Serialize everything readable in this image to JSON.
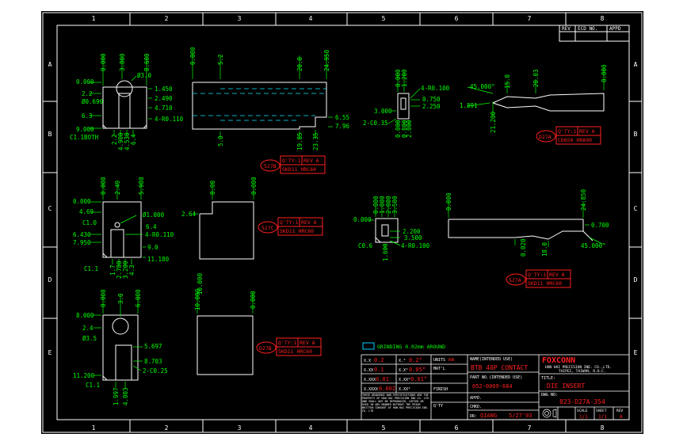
{
  "zones": {
    "cols": [
      "1",
      "2",
      "3",
      "4",
      "5",
      "6",
      "7",
      "8"
    ],
    "rows": [
      "A",
      "B",
      "C",
      "D",
      "E"
    ]
  },
  "revision_block": {
    "rev": "REV",
    "ecd_no": "ECD NO.",
    "appd": "APPD"
  },
  "colors": {
    "background": "#000000",
    "outline": "#ffffff",
    "dimension": "#00ff00",
    "hidden": "#00e5ff",
    "tag": "#ff2020",
    "text": "#ffffff"
  },
  "views": {
    "a1": {
      "dims_top": [
        "0.000",
        "3.800",
        "8.600"
      ],
      "dims_left": [
        "0.000",
        "2.2",
        "Ø0.690",
        "6.3",
        "9.000",
        "C1.1BOTH"
      ],
      "dims_right": [
        "Ø3.0",
        "1.450",
        "2.490",
        "4.710",
        "4-R0.110"
      ],
      "dims_bottom": [
        "2.2",
        "4.900",
        "4.530",
        "6.4"
      ]
    },
    "a2": {
      "dims_top": [
        "0.000",
        "5.2",
        "20.0",
        "24.950"
      ],
      "dims_right": [
        "6.55",
        "7.96"
      ],
      "dims_bottom": [
        "5.0",
        "19.85",
        "23.35"
      ],
      "tag_code": "527B",
      "tag_qty": "Q'TY:1",
      "tag_rev": "REV A",
      "tag_mat": "SKD11 HRC60"
    },
    "a3": {
      "dims": [
        "0.000",
        "1.200",
        "4-R0.100",
        "0.750",
        "2.250",
        "3.000",
        "2-C0.35",
        "0.000",
        "0.800",
        "2.000"
      ]
    },
    "a4": {
      "dims": [
        "45.000°",
        "15.0",
        "20.03",
        "0.000",
        "1.891",
        "21.200"
      ],
      "tag_code": "D27A",
      "tag_qty": "Q'TY:1",
      "tag_rev": "REV A",
      "tag_mat": "CD650 HRA90"
    },
    "c1": {
      "dims_top": [
        "0.000",
        "2.49",
        "5.980"
      ],
      "dims_left": [
        "0.000",
        "4.69",
        "C1.0",
        "6.430",
        "7.950",
        "C1.1"
      ],
      "dims_right": [
        "Ø1.000",
        "6.4",
        "4-R0.110",
        "9.0",
        "11.180"
      ],
      "dims_bottom": [
        "1.7",
        "2.780",
        "3.200",
        "4.3"
      ]
    },
    "c2": {
      "dims": [
        "8.00",
        "0.000",
        "2.64",
        "10.000"
      ],
      "tag_code": "527C",
      "tag_qty": "Q'TY:1",
      "tag_rev": "REV A",
      "tag_mat": "SKD11 HRC60"
    },
    "c3": {
      "dims": [
        "0.000",
        "1.000",
        "2.000",
        "3.500",
        "0.000",
        "2.200",
        "3.500",
        "4-R0.100",
        "C0.6",
        "1.600"
      ]
    },
    "c4": {
      "dims": [
        "0.000",
        "24.850",
        "0.700",
        "45.000°",
        "0.020",
        "18.0"
      ],
      "tag_code": "527A",
      "tag_qty": "Q'TY:1",
      "tag_rev": "REV A",
      "tag_mat": "SKD11 HRC60"
    },
    "d1": {
      "dims_top": [
        "0.000",
        "3.0",
        "6.000"
      ],
      "dims_left": [
        "8.000",
        "2.4",
        "Ø3.5",
        "11.200",
        "C1.1"
      ],
      "dims_right": [
        "5.697",
        "8.703",
        "2-C0.25"
      ],
      "dims_bottom": [
        "1.997",
        "4.003"
      ]
    },
    "d2": {
      "dims": [
        "10.000",
        "0.000"
      ],
      "tag_code": "D27B",
      "tag_qty": "Q'TY:1",
      "tag_rev": "REV A",
      "tag_mat": "SKD11 HRC60"
    }
  },
  "grinding_note": "GRINDING 0.02mm AROUND",
  "title_block": {
    "tolerances": [
      {
        "x": "X.X",
        "val": "0.2",
        "deg": "X.°",
        "dval": "0.2°"
      },
      {
        "x": "X.XX",
        "val": "0.1",
        "deg": "X.X°",
        "dval": "0.05°"
      },
      {
        "x": "X.XXX",
        "val": "0.01",
        "deg": "X.XX°",
        "dval": "0.01°"
      },
      {
        "x": "X.XXXX",
        "val": "0.002",
        "deg": "X.XX°",
        "dval": ""
      }
    ],
    "units_label": "UNITS",
    "units_value": "mm",
    "matl_label": "MAT'L",
    "finish_label": "FINISH",
    "qty_label": "Q'TY",
    "note": "THESE DRAWINGS AND SPECIFICATIONS ARE THE PROPERTY OF HON HAI PRECISION IND CO. LTD. AND SHALL NOT BE REPRODUCED, COPIED OR USED IN ANY MANNER WITHOUT THE PRIOR WRITTEN CONSENT OF HON HAI PRECISION IND. CO. LTD",
    "name_label": "NAME(INTENDED USE)",
    "name_value": "BTB 40P CONTACT",
    "part_label": "PART NO.(INTENDED USE)",
    "part_value": "052-0009-684",
    "appd_label": "APPD.",
    "chkd_label": "CHKD.",
    "dr_label": "DR:",
    "dr_value": "QIANG",
    "dr_date": "5/27'03",
    "logo": "FOXCONN",
    "company": "HON HAI PRECISION IND. CO.,LTD.",
    "location": "TAIPEI, TAIWAN, R.O.C.",
    "title_label": "TITLE:",
    "title_value": "DIE INSERT",
    "dwg_label": "DWG NO:",
    "dwg_value": "823-D27A-354",
    "scale_label": "SCALE",
    "scale_value": "1/1",
    "sheet_label": "SHEET",
    "sheet_value": "1/1",
    "rev_label": "REV",
    "rev_value": "A"
  }
}
